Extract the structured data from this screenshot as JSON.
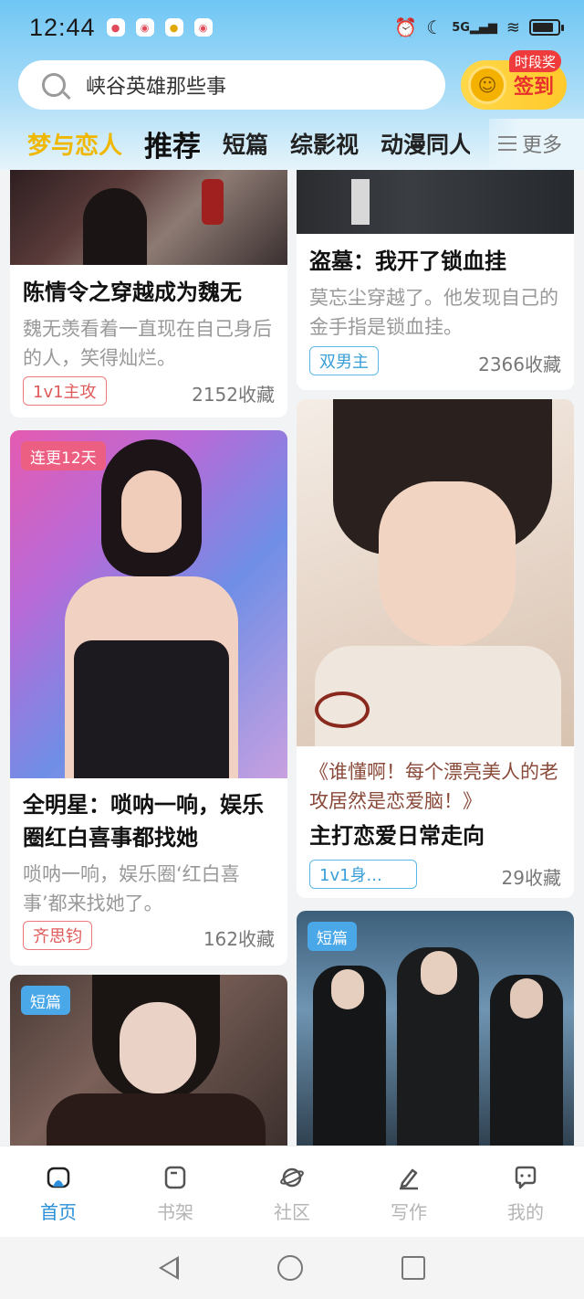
{
  "status_bar": {
    "time": "12:44",
    "notification_icons": [
      "qq-icon",
      "weibo-icon",
      "app-icon",
      "weibo-icon"
    ],
    "system_icons": [
      "alarm-icon",
      "moon-icon",
      "5g-signal-icon",
      "wifi-icon",
      "battery-icon"
    ],
    "network_label": "5G"
  },
  "search": {
    "placeholder": "峡谷英雄那些事"
  },
  "signin": {
    "label": "签到",
    "badge": "时段奖"
  },
  "tabs": [
    {
      "label": "梦与恋人"
    },
    {
      "label": "推荐"
    },
    {
      "label": "短篇"
    },
    {
      "label": "综影视"
    },
    {
      "label": "动漫同人"
    }
  ],
  "more_label": "更多",
  "cards": {
    "c1": {
      "title": "陈情令之穿越成为魏无",
      "desc": "魏无羡看着一直现在自己身后的人，笑得灿烂。",
      "tag": "1v1主攻",
      "count": "2152收藏"
    },
    "c2": {
      "title": "盗墓：我开了锁血挂",
      "desc": "莫忘尘穿越了。他发现自己的金手指是锁血挂。",
      "tag": "双男主",
      "count": "2366收藏"
    },
    "c3": {
      "ribbon": "连更12天",
      "title": "全明星：唢呐一响，娱乐圈红白喜事都找她",
      "desc": "唢呐一响，娱乐圈‘红白喜事’都来找她了。",
      "tag": "齐思钧",
      "count": "162收藏"
    },
    "c4": {
      "quote": "《谁懂啊！每个漂亮美人的老攻居然是恋爱脑！》",
      "title": "主打恋爱日常走向",
      "tag": "1v1身...",
      "count": "29收藏"
    },
    "c5": {
      "ribbon": "短篇"
    },
    "c6": {
      "ribbon": "短篇"
    }
  },
  "bottom_nav": [
    {
      "label": "首页",
      "icon": "home-icon",
      "active": true
    },
    {
      "label": "书架",
      "icon": "bookshelf-icon",
      "active": false
    },
    {
      "label": "社区",
      "icon": "planet-icon",
      "active": false
    },
    {
      "label": "写作",
      "icon": "pen-icon",
      "active": false
    },
    {
      "label": "我的",
      "icon": "chat-bubble-icon",
      "active": false
    }
  ],
  "colors": {
    "accent": "#2a8fd8",
    "highlight_tab": "#f0b700",
    "signin_bg": "#ffc92b",
    "badge_red": "#ef3b3b"
  }
}
